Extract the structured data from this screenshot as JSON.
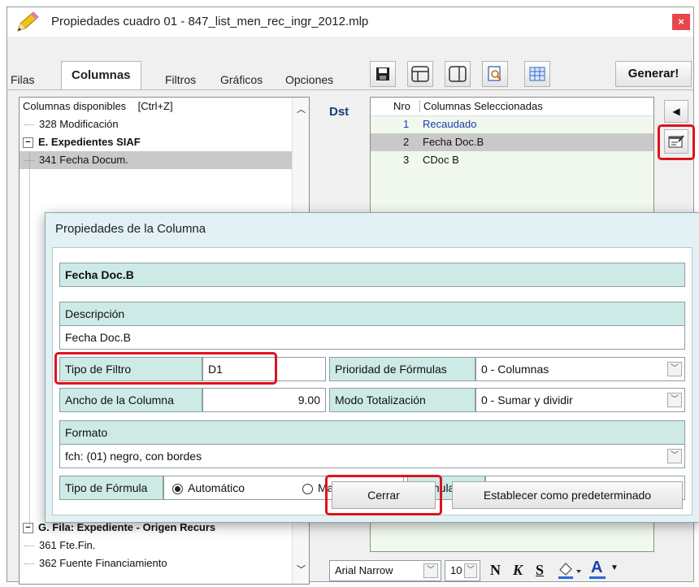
{
  "window": {
    "title": "Propiedades cuadro 01 - 847_list_men_rec_ingr_2012.mlp",
    "close": "×"
  },
  "tabs": [
    "Filas",
    "Columnas",
    "Filtros",
    "Gráficos",
    "Opciones"
  ],
  "active_tab": "Columnas",
  "toolbar": {
    "generate_label": "Generar!",
    "icons": [
      "save-icon",
      "layout-rows-icon",
      "layout-columns-icon",
      "preview-icon",
      "grid-icon"
    ]
  },
  "available": {
    "header": "Columnas disponibles",
    "shortcut": "[Ctrl+Z]",
    "items": [
      {
        "label": "328 Modificación",
        "type": "leaf"
      },
      {
        "label": "E. Expedientes SIAF",
        "type": "group"
      },
      {
        "label": "341 Fecha Docum.",
        "type": "leaf",
        "selected": true
      }
    ],
    "bottom_items": [
      {
        "label": "G. Fila: Expediente - Origen Recurs",
        "type": "group"
      },
      {
        "label": "361 Fte.Fin.",
        "type": "leaf"
      },
      {
        "label": "362 Fuente Financiamiento",
        "type": "leaf"
      }
    ]
  },
  "dst_label": "Dst",
  "selected": {
    "nro_header": "Nro",
    "col_header": "Columnas Seleccionadas",
    "rows": [
      {
        "nro": "1",
        "label": "Recaudado"
      },
      {
        "nro": "2",
        "label": "Fecha Doc.B",
        "selected": true
      },
      {
        "nro": "3",
        "label": "CDoc B"
      }
    ]
  },
  "dialog": {
    "title": "Propiedades de la Columna",
    "column_name": "Fecha Doc.B",
    "descripcion_label": "Descripción",
    "descripcion_value": "Fecha Doc.B",
    "tipo_filtro_label": "Tipo de Filtro",
    "tipo_filtro_value": "D1",
    "prioridad_label": "Prioridad de Fórmulas",
    "prioridad_value": "0 - Columnas",
    "ancho_label": "Ancho de la Columna",
    "ancho_value": "9.00",
    "modo_label": "Modo Totalización",
    "modo_value": "0 - Sumar y dividir",
    "formato_label": "Formato",
    "formato_value": "fch: (01) negro, con bordes",
    "tipo_formula_label": "Tipo de Fórmula",
    "radio_auto": "Automático",
    "radio_manual": "Manual",
    "formula_label": "Fórmula",
    "formula_value": "",
    "cerrar": "Cerrar",
    "predeterminado": "Establecer como predeterminado"
  },
  "format_bar": {
    "font": "Arial Narrow",
    "size": "10",
    "bold": "N",
    "italic": "K",
    "underline": "S",
    "color_letter": "A"
  },
  "colors": {
    "highlight": "#e0121b",
    "dialog_bg": "#e2f1f3",
    "header_teal": "#cdeae7",
    "list_blue": "#1a3fa8"
  }
}
